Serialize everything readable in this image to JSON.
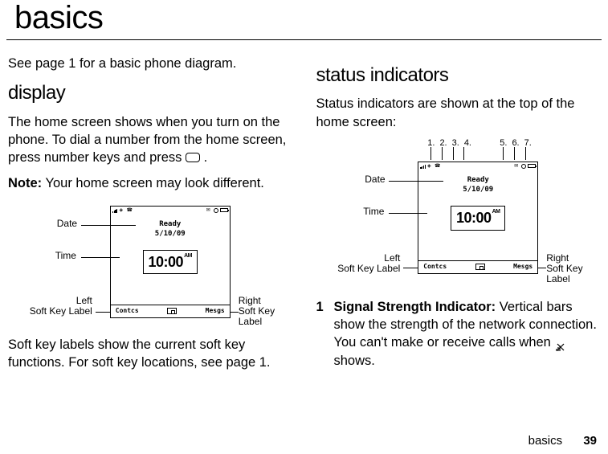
{
  "page": {
    "title": "basics",
    "intro": "See page 1 for a basic phone diagram."
  },
  "col1": {
    "display_heading": "display",
    "p1_part1": "The home screen shows when you turn on the phone. To dial a number from the home screen, press number keys and press ",
    "p1_part2": ".",
    "note_label": "Note:",
    "note_text": " Your home screen may look different.",
    "softkey_caption": "Soft key labels show the current soft key functions. For soft key locations, see page 1."
  },
  "col2": {
    "status_heading": "status indicators",
    "p1": "Status indicators are shown at the top of the home screen:",
    "item1_num": "1",
    "item1_title": "Signal Strength Indicator:",
    "item1_text_a": " Vertical bars show the strength of the network connection. You can't make or receive calls when ",
    "item1_text_b": " shows."
  },
  "phone": {
    "ready": "Ready",
    "date": "5/10/09",
    "time": "10:00",
    "ampm": "AM",
    "left_soft": "Contcs",
    "right_soft": "Mesgs"
  },
  "labels": {
    "date": "Date",
    "time": "Time",
    "left_soft_line1": "Left",
    "left_soft_line2": "Soft Key Label",
    "right_soft_line1": "Right",
    "right_soft_line2": "Soft Key Label"
  },
  "numbers": {
    "n1": "1.",
    "n2": "2.",
    "n3": "3.",
    "n4": "4.",
    "n5": "5.",
    "n6": "6.",
    "n7": "7."
  },
  "footer": {
    "word": "basics",
    "page": "39"
  }
}
